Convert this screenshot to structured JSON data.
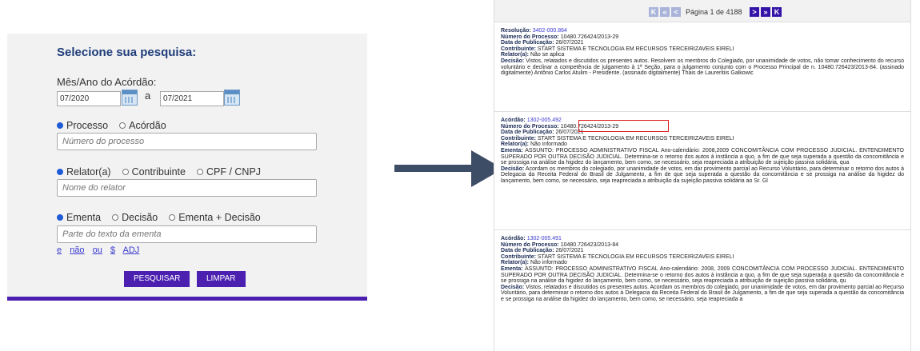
{
  "form": {
    "title": "Selecione sua pesquisa:",
    "date_label": "Mês/Ano do Acórdão:",
    "date_from": "07/2020",
    "date_sep": "a",
    "date_to": "07/2021",
    "row1": {
      "opt1": "Processo",
      "opt2": "Acórdão",
      "placeholder": "Número do processo"
    },
    "row2": {
      "opt1": "Relator(a)",
      "opt2": "Contribuinte",
      "opt3": "CPF / CNPJ",
      "placeholder": "Nome do relator"
    },
    "row3": {
      "opt1": "Ementa",
      "opt2": "Decisão",
      "opt3": "Ementa + Decisão",
      "placeholder": "Parte do texto da ementa"
    },
    "ops": [
      "e",
      "não",
      "ou",
      "$",
      "ADJ"
    ],
    "search_btn": "PESQUISAR",
    "clear_btn": "LIMPAR"
  },
  "pager": {
    "first": "K",
    "prev_fast": "«",
    "prev": "<",
    "text": "Página 1 de 4188",
    "next": ">",
    "next_fast": "»",
    "last": "K"
  },
  "records": [
    {
      "l1_label": "Resolução:",
      "l1_value": "3402-000.864",
      "proc_label": "Número do Processo:",
      "proc_value": "10480.726424/2013-29",
      "date_label": "Data de Publicação:",
      "date_value": "26/07/2021",
      "contrib_label": "Contribuinte:",
      "contrib_value": "START SISTEMA E TECNOLOGIA EM RECURSOS TERCEIRIZAVEIS EIRELI",
      "relator_label": "Relator(a):",
      "relator_value": "Não se aplica",
      "decisao_label": "Decisão:",
      "decisao_value": "Vistos, relatados e discutidos os presentes autos. Resolvem os membros do Colegiado, por unanimidade de votos, não tomar conhecimento do recurso voluntário e declinar a competência de julgamento à 1ª Seção, para o julgamento conjunto com o Processo Principal de n. 10480.726423/2013-84. (assinado digitalmente) Antônio Carlos Atulim - Presidente. (assinado digitalmente) Thais de Laurentiis Galkowic"
    },
    {
      "l1_label": "Acórdão:",
      "l1_value": "1302-005.492",
      "proc_label": "Número do Processo:",
      "proc_value": "10480.726424/2013-29",
      "date_label": "Data de Publicação:",
      "date_value": "26/07/2021",
      "contrib_label": "Contribuinte:",
      "contrib_value": "START SISTEMA E TECNOLOGIA EM RECURSOS TERCEIRIZAVEIS EIRELI",
      "relator_label": "Relator(a):",
      "relator_value": "Não informado",
      "ementa_label": "Ementa:",
      "ementa_value": "ASSUNTO: PROCESSO ADMINISTRATIVO FISCAL Ano-calendário: 2008,2009 CONCOMITÂNCIA COM PROCESSO JUDICIAL. ENTENDIMENTO SUPERADO POR OUTRA DECISÃO JUDICIAL. Determina-se o retorno dos autos à instância a quo, a fim de que seja superada a questão da concomitância e se prossiga na análise da higidez do lançamento, bem como, se necessário, seja reapreciada a atribuição de sujeição passiva solidária, qua",
      "decisao_label": "Decisão:",
      "decisao_value": "Acordam os membros do colegiado, por unanimidade de votos, em dar provimento parcial ao Recurso Voluntário, para determinar o retorno dos autos à Delegacia da Receita Federal do Brasil de Julgamento, a fim de que seja superada a questão da concomitância e se prossiga na análise da higidez do lançamento, bem como, se necessário, seja reapreciada a atribuição da sujeição passiva solidária ao Sr. Gl"
    },
    {
      "l1_label": "Acórdão:",
      "l1_value": "1302-005.491",
      "proc_label": "Número do Processo:",
      "proc_value": "10480.726423/2013-84",
      "date_label": "Data de Publicação:",
      "date_value": "26/07/2021",
      "contrib_label": "Contribuinte:",
      "contrib_value": "START SISTEMA E TECNOLOGIA EM RECURSOS TERCEIRIZAVEIS EIRELI",
      "relator_label": "Relator(a):",
      "relator_value": "Não informado",
      "ementa_label": "Ementa:",
      "ementa_value": "ASSUNTO: PROCESSO ADMINISTRATIVO FISCAL Ano-calendário: 2008, 2009 CONCOMITÂNCIA COM PROCESSO JUDICIAL. ENTENDIMENTO SUPERADO POR OUTRA DECISÃO JUDICIAL. Determina-se o retorno dos autos à instância a quo, a fim de que seja superada a questão da concomitância e se prossiga na análise da higidez do lançamento, bem como, se necessário, seja reapreciada a atribuição de sujeição passiva solidária, qu",
      "decisao_label": "Decisão:",
      "decisao_value": "Vistos, relatados e discutidos os presentes autos. Acordam os membros do colegiado, por unanimidade de votos, em dar provimento parcial ao Recurso Voluntário, para determinar o retorno dos autos à Delegacia da Receita Federal do Brasil de Julgamento, a fim de que seja superada a questão da concomitância e se prossiga na análise da higidez do lançamento, bem como, se necessário, seja reapreciada a"
    }
  ]
}
